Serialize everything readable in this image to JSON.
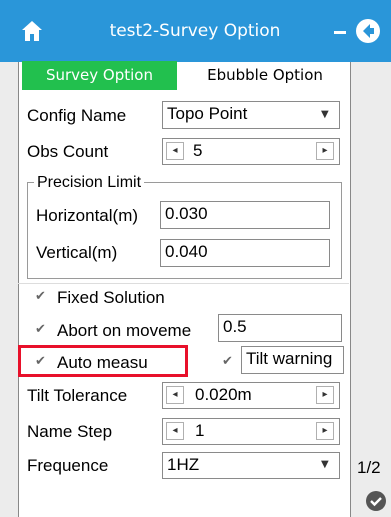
{
  "app": {
    "title": "test2-Survey Option"
  },
  "tabs": [
    {
      "label": "Survey Option"
    },
    {
      "label": "Ebubble Option"
    }
  ],
  "form": {
    "config_name": {
      "label": "Config Name",
      "value": "Topo Point"
    },
    "obs_count": {
      "label": "Obs Count",
      "value": "5"
    },
    "precision": {
      "group_label": "Precision Limit",
      "horizontal": {
        "label": "Horizontal(m)",
        "value": "0.030"
      },
      "vertical": {
        "label": "Vertical(m)",
        "value": "0.040"
      }
    },
    "fixed_solution": {
      "label": "Fixed Solution",
      "checked": true
    },
    "abort_on_movement": {
      "label": "Abort on moveme",
      "value": "0.5",
      "checked": true
    },
    "auto_measure": {
      "label": "Auto measu",
      "checked": true
    },
    "tilt_warning": {
      "label": "Tilt warning",
      "checked": true
    },
    "tilt_tolerance": {
      "label": "Tilt Tolerance",
      "value": "0.020m"
    },
    "name_step": {
      "label": "Name Step",
      "value": "1"
    },
    "frequence": {
      "label": "Frequence",
      "value": "1HZ"
    }
  },
  "page_indicator": "1/2",
  "colors": {
    "topbar": "#2a96d9",
    "active_tab": "#22c04e",
    "highlight": "#e8102a"
  },
  "icons": {
    "home": "home-icon",
    "minimize": "minus-icon",
    "back": "back-arrow-icon",
    "confirm": "check-circle-icon"
  }
}
